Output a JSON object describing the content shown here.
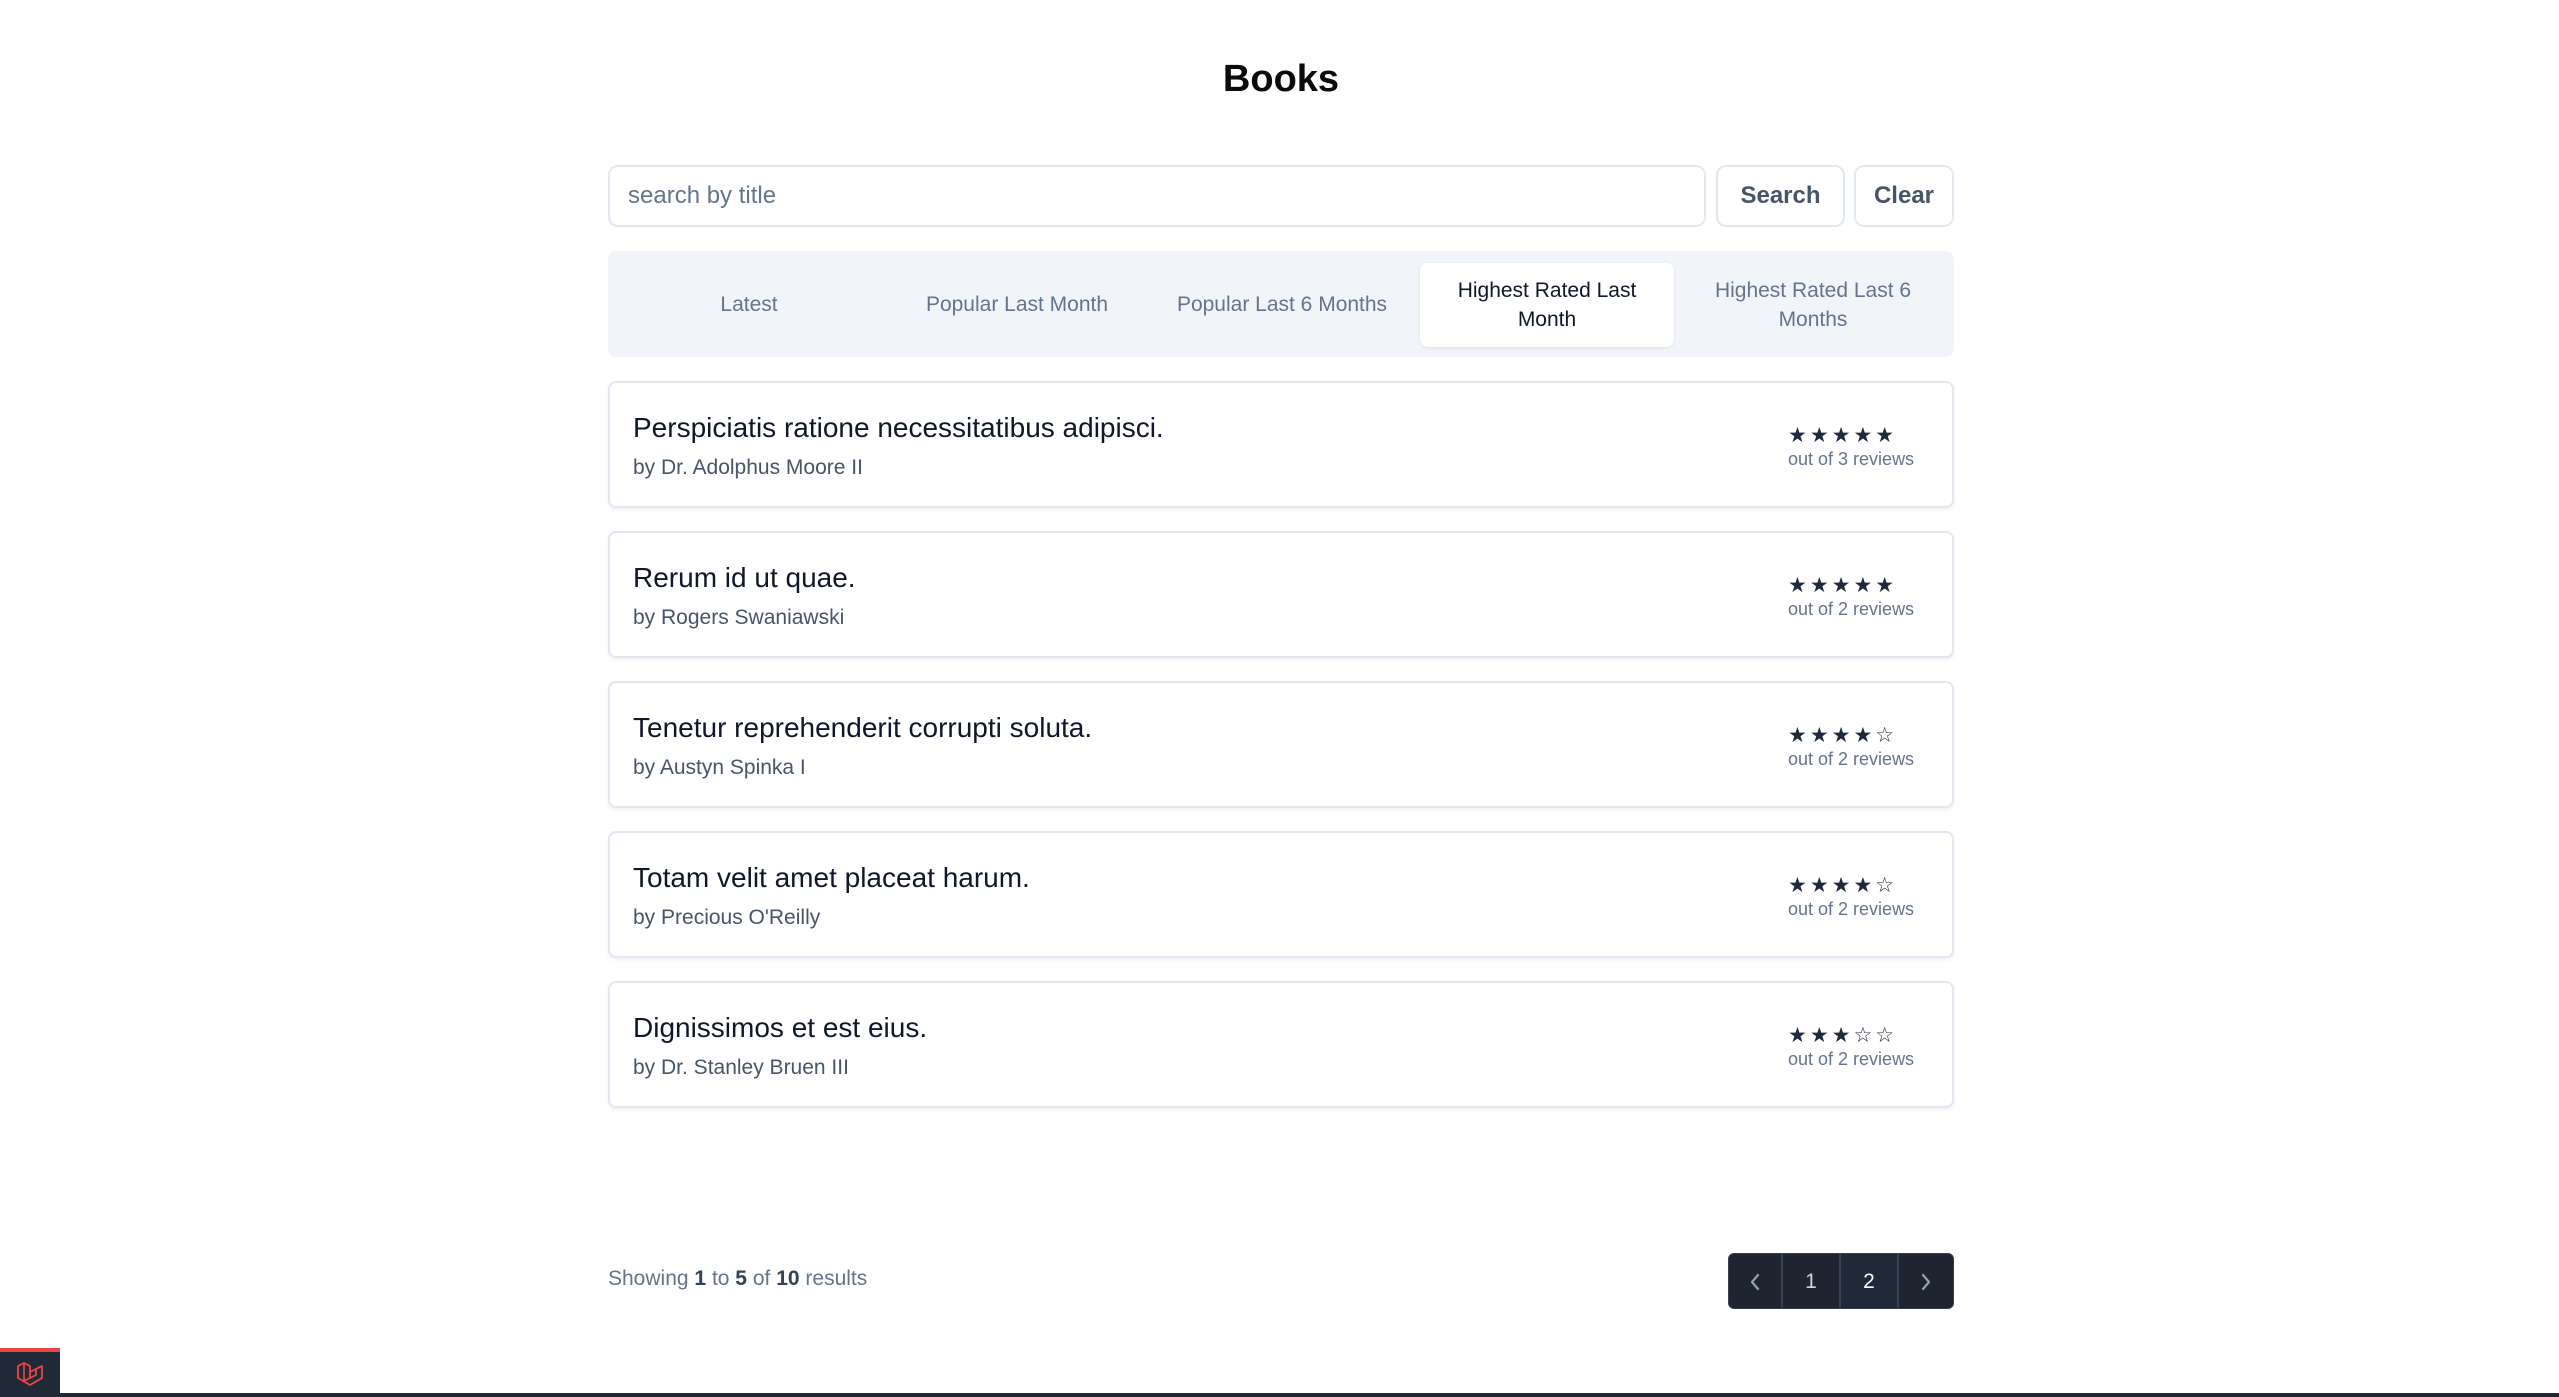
{
  "page": {
    "title": "Books"
  },
  "search": {
    "placeholder": "search by title",
    "value": "",
    "search_label": "Search",
    "clear_label": "Clear"
  },
  "tabs": [
    {
      "label": "Latest",
      "active": false
    },
    {
      "label": "Popular Last Month",
      "active": false
    },
    {
      "label": "Popular Last 6 Months",
      "active": false
    },
    {
      "label": "Highest Rated Last Month",
      "active": true
    },
    {
      "label": "Highest Rated Last 6 Months",
      "active": false
    }
  ],
  "books": [
    {
      "title": "Perspiciatis ratione necessitatibus adipisci.",
      "author": "by Dr. Adolphus Moore II",
      "stars": "★★★★★",
      "rating_out_of_5": 5,
      "reviews": "out of 3 reviews"
    },
    {
      "title": "Rerum id ut quae.",
      "author": "by Rogers Swaniawski",
      "stars": "★★★★★",
      "rating_out_of_5": 5,
      "reviews": "out of 2 reviews"
    },
    {
      "title": "Tenetur reprehenderit corrupti soluta.",
      "author": "by Austyn Spinka I",
      "stars": "★★★★☆",
      "rating_out_of_5": 4,
      "reviews": "out of 2 reviews"
    },
    {
      "title": "Totam velit amet placeat harum.",
      "author": "by Precious O'Reilly",
      "stars": "★★★★☆",
      "rating_out_of_5": 4,
      "reviews": "out of 2 reviews"
    },
    {
      "title": "Dignissimos et est eius.",
      "author": "by Dr. Stanley Bruen III",
      "stars": "★★★☆☆",
      "rating_out_of_5": 3,
      "reviews": "out of 2 reviews"
    }
  ],
  "pagination": {
    "showing_prefix": "Showing",
    "from": "1",
    "to_word": "to",
    "to": "5",
    "of_word": "of",
    "total": "10",
    "suffix": "results",
    "pages": [
      "1",
      "2"
    ],
    "current_page": "2",
    "prev_icon": "chevron-left-icon",
    "next_icon": "chevron-right-icon"
  },
  "debug_badge": {
    "icon": "laravel-logo-icon"
  },
  "colors": {
    "accent_dark": "#1e2430",
    "badge_red": "#ef4444",
    "tab_bg": "#f1f5f9"
  }
}
